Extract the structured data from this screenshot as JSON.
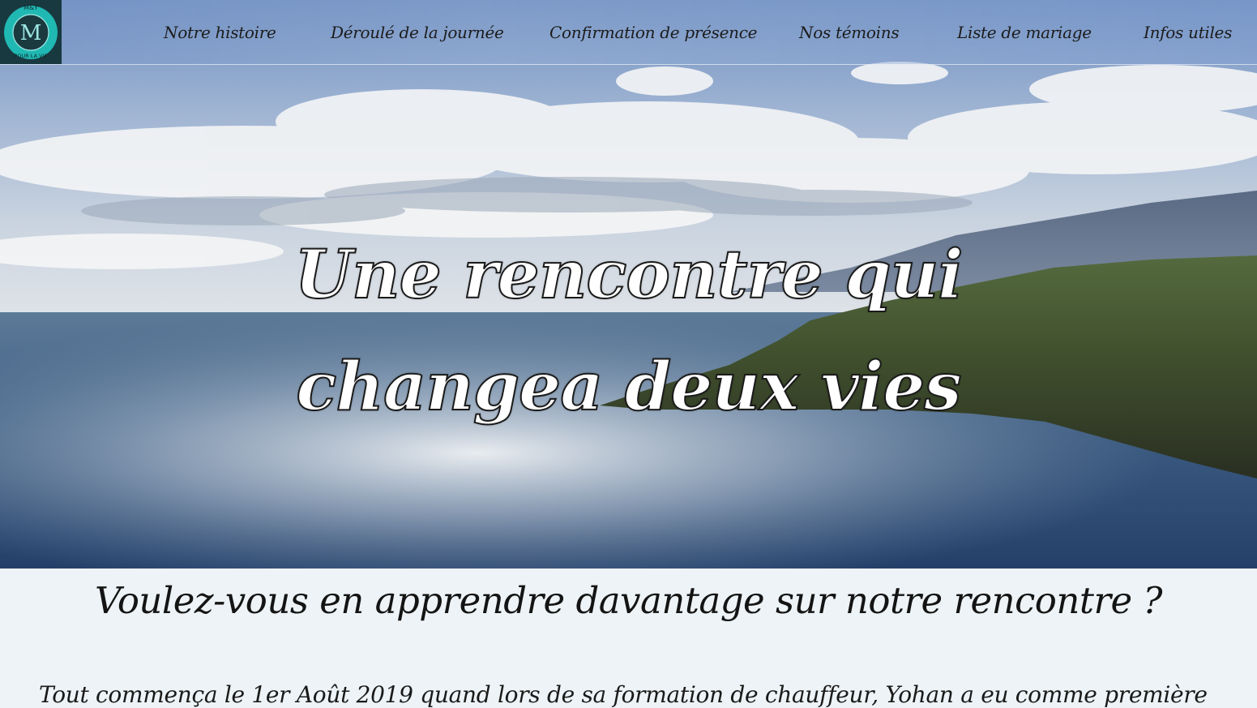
{
  "logo": {
    "top_text": "M&Y",
    "letter": "M",
    "bottom_text": "POUR LA VIE",
    "icon": "wedding-monogram-logo"
  },
  "nav": {
    "items": [
      {
        "label": "Notre histoire"
      },
      {
        "label": "Déroulé de la journée"
      },
      {
        "label": "Confirmation de présence"
      },
      {
        "label": "Nos témoins"
      },
      {
        "label": "Liste de mariage"
      },
      {
        "label": "Infos utiles"
      }
    ]
  },
  "hero": {
    "line1": "Une rencontre qui",
    "line2": "changea deux vies",
    "image": "coastal-sea-landscape"
  },
  "section": {
    "question": "Voulez-vous en apprendre davantage sur notre rencontre ?",
    "story_start": "Tout commença le 1er Août 2019 quand lors de sa formation de chauffeur, Yohan a eu comme première"
  },
  "colors": {
    "accent": "#1fb5b0",
    "nav_text": "#1c1c1c",
    "background": "#edf3f6"
  }
}
